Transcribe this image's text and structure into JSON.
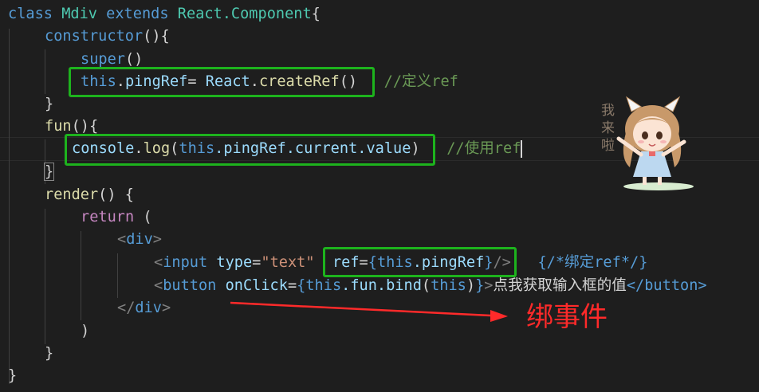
{
  "code": {
    "line1": {
      "kw1": "class",
      "name": "Mdiv",
      "kw2": "extends",
      "base": "React.Component",
      "open": "{"
    },
    "line2": {
      "fn": "constructor",
      "rest": "(){"
    },
    "line3": {
      "kw": "super",
      "rest": "()"
    },
    "line4": {
      "this": "this",
      "dot": ".",
      "prop": "pingRef",
      "eq": "= ",
      "obj": "React",
      "dot2": ".",
      "method": "createRef",
      "paren": "()",
      "comment": "//定义ref"
    },
    "line5": {
      "text": "}"
    },
    "line6": {
      "fn": "fun",
      "rest": "(){"
    },
    "line7": {
      "obj": "console",
      "dot": ".",
      "method": "log",
      "open": "(",
      "this": "this",
      "prop": ".pingRef.current.value",
      "close": ")",
      "comment": "//使用ref"
    },
    "line8": {
      "text": "}"
    },
    "line9": {
      "fn": "render",
      "rest": "() {"
    },
    "line10": {
      "kw": "return",
      "rest": " ("
    },
    "line11": {
      "lt": "<",
      "tag": "div",
      "gt": ">"
    },
    "line12": {
      "lt": "<",
      "tag": "input",
      "attr1": "type",
      "eq1": "=",
      "val1": "\"text\"",
      "attr2": "ref",
      "eq2": "=",
      "lb": "{",
      "this": "this",
      "prop": ".pingRef",
      "rb": "}",
      "close": "/>",
      "comment": "{/*绑定ref*/}"
    },
    "line13": {
      "lt": "<",
      "tag": "button",
      "attr": "onClick",
      "eq": "=",
      "lb": "{",
      "this": "this",
      "prop": ".fun.bind",
      "p1": "(",
      "arg": "this",
      "p2": ")",
      "rb": "}",
      "gt": ">",
      "text": "点我获取输入框的值",
      "closetag": "</button>"
    },
    "line14": {
      "lt": "</",
      "tag": "div",
      "gt": ">"
    },
    "line15": {
      "text": ")"
    },
    "line16": {
      "text": "}"
    },
    "line17": {
      "text": "}"
    }
  },
  "annotation": {
    "text": "绑事件"
  },
  "sticker": {
    "text": "我来啦"
  },
  "colors": {
    "highlight_box": "#1db31d",
    "arrow": "#ff2a2a",
    "background": "#1e1e1e"
  }
}
